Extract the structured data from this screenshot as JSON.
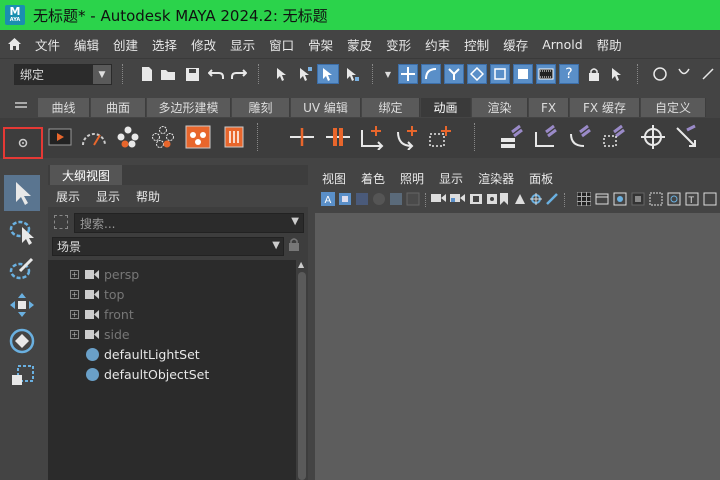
{
  "titlebar": {
    "logo_text": "M",
    "logo_sub": "AYA",
    "title": "无标题* - Autodesk MAYA 2024.2: 无标题"
  },
  "menubar": {
    "items": [
      "文件",
      "编辑",
      "创建",
      "选择",
      "修改",
      "显示",
      "窗口",
      "骨架",
      "蒙皮",
      "变形",
      "约束",
      "控制",
      "缓存",
      "Arnold",
      "帮助"
    ]
  },
  "toolbar": {
    "mode_value": "绑定"
  },
  "shelf": {
    "tabs": [
      "曲线",
      "曲面",
      "多边形建模",
      "雕刻",
      "UV 编辑",
      "绑定",
      "动画",
      "渲染",
      "FX",
      "FX 缓存",
      "自定义"
    ],
    "active_tab": "动画"
  },
  "outliner": {
    "tab_label": "大纲视图",
    "menu": [
      "展示",
      "显示",
      "帮助"
    ],
    "search_placeholder": "搜索...",
    "scene_value": "场景",
    "items": [
      {
        "label": "persp",
        "type": "camera"
      },
      {
        "label": "top",
        "type": "camera"
      },
      {
        "label": "front",
        "type": "camera"
      },
      {
        "label": "side",
        "type": "camera"
      },
      {
        "label": "defaultLightSet",
        "type": "set"
      },
      {
        "label": "defaultObjectSet",
        "type": "set"
      }
    ]
  },
  "viewport": {
    "menu": [
      "视图",
      "着色",
      "照明",
      "显示",
      "渲染器",
      "面板"
    ]
  },
  "colors": {
    "titlebar": "#2bd34b",
    "accent_blue": "#5a8fc8",
    "highlight_red": "#e53935",
    "orange_icon": "#e8662c"
  }
}
